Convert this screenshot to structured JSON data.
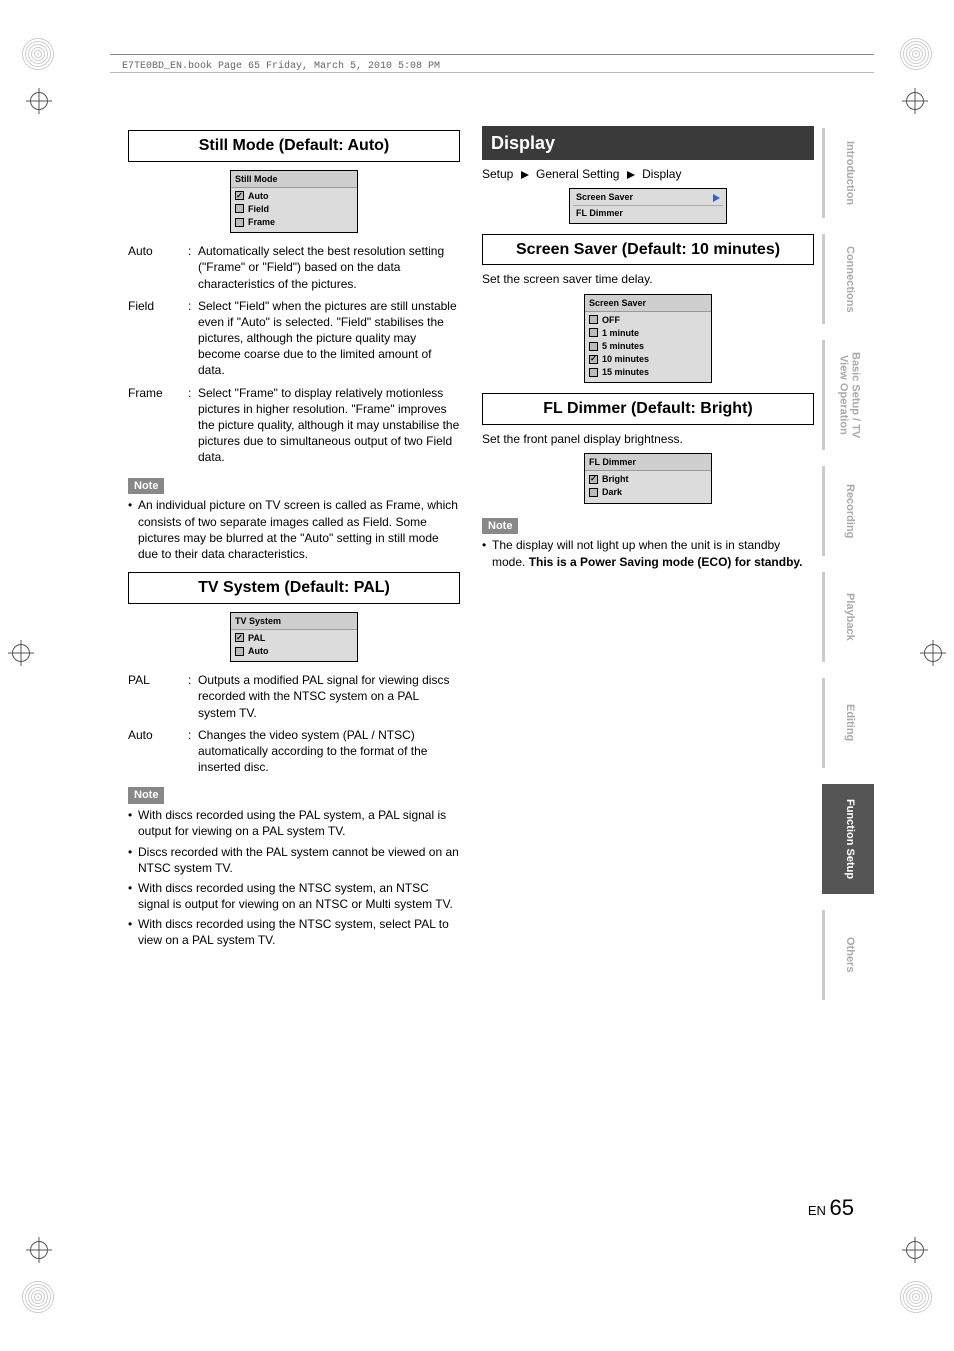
{
  "crop_header": "E7TE0BD_EN.book  Page 65  Friday, March 5, 2010  5:08 PM",
  "page_lang": "EN",
  "page_number": "65",
  "sidetabs": [
    {
      "label": "Introduction",
      "active": false
    },
    {
      "label": "Connections",
      "active": false
    },
    {
      "label": "Basic Setup / TV View Operation",
      "active": false,
      "twoline": true
    },
    {
      "label": "Recording",
      "active": false
    },
    {
      "label": "Playback",
      "active": false
    },
    {
      "label": "Editing",
      "active": false
    },
    {
      "label": "Function Setup",
      "active": true
    },
    {
      "label": "Others",
      "active": false
    }
  ],
  "left": {
    "still_mode": {
      "title": "Still Mode (Default: Auto)",
      "menu_title": "Still Mode",
      "options": [
        {
          "label": "Auto",
          "checked": true
        },
        {
          "label": "Field",
          "checked": false
        },
        {
          "label": "Frame",
          "checked": false
        }
      ],
      "defs": [
        {
          "term": "Auto",
          "desc": "Automatically select the best resolution setting (\"Frame\" or \"Field\") based on the data characteristics of the pictures."
        },
        {
          "term": "Field",
          "desc": "Select \"Field\" when the pictures are still unstable even if \"Auto\" is selected. \"Field\" stabilises the pictures, although the picture quality may become coarse due to the limited amount of data."
        },
        {
          "term": "Frame",
          "desc": "Select \"Frame\" to display relatively motionless pictures in higher resolution. \"Frame\" improves the picture quality, although it may unstabilise the pictures due to simultaneous output of two Field data."
        }
      ],
      "note_label": "Note",
      "notes": [
        "An individual picture on TV screen is called as Frame, which consists of two separate images called as Field. Some pictures may be blurred at the \"Auto\" setting in still mode due to their data characteristics."
      ]
    },
    "tv_system": {
      "title": "TV System (Default: PAL)",
      "menu_title": "TV System",
      "options": [
        {
          "label": "PAL",
          "checked": true
        },
        {
          "label": "Auto",
          "checked": false
        }
      ],
      "defs": [
        {
          "term": "PAL",
          "desc": "Outputs a modified PAL signal for viewing discs recorded with the NTSC system on a PAL system TV."
        },
        {
          "term": "Auto",
          "desc": "Changes the video system (PAL / NTSC) automatically according to the format of the inserted disc."
        }
      ],
      "note_label": "Note",
      "notes": [
        "With discs recorded using the PAL system, a PAL signal is output for viewing on a PAL system TV.",
        "Discs recorded with the PAL system cannot be viewed on an NTSC system TV.",
        "With discs recorded using the NTSC system, an NTSC signal is output for viewing on an NTSC or Multi system TV.",
        "With discs recorded using the NTSC system, select PAL to view on a PAL system TV."
      ]
    }
  },
  "right": {
    "display": {
      "title": "Display",
      "breadcrumb": [
        "Setup",
        "General Setting",
        "Display"
      ],
      "panel_items": [
        "Screen Saver",
        "FL Dimmer"
      ]
    },
    "screen_saver": {
      "title": "Screen Saver (Default: 10 minutes)",
      "lead": "Set the screen saver time delay.",
      "menu_title": "Screen Saver",
      "options": [
        {
          "label": "OFF",
          "checked": false
        },
        {
          "label": "1 minute",
          "checked": false
        },
        {
          "label": "5 minutes",
          "checked": false
        },
        {
          "label": "10 minutes",
          "checked": true
        },
        {
          "label": "15 minutes",
          "checked": false
        }
      ]
    },
    "fl_dimmer": {
      "title": "FL Dimmer (Default: Bright)",
      "lead": "Set the front panel display brightness.",
      "menu_title": "FL Dimmer",
      "options": [
        {
          "label": "Bright",
          "checked": true
        },
        {
          "label": "Dark",
          "checked": false
        }
      ],
      "note_label": "Note",
      "note_pre": "The display will not light up when the unit is in standby mode. ",
      "note_bold": "This is a Power Saving mode (ECO) for standby."
    }
  }
}
